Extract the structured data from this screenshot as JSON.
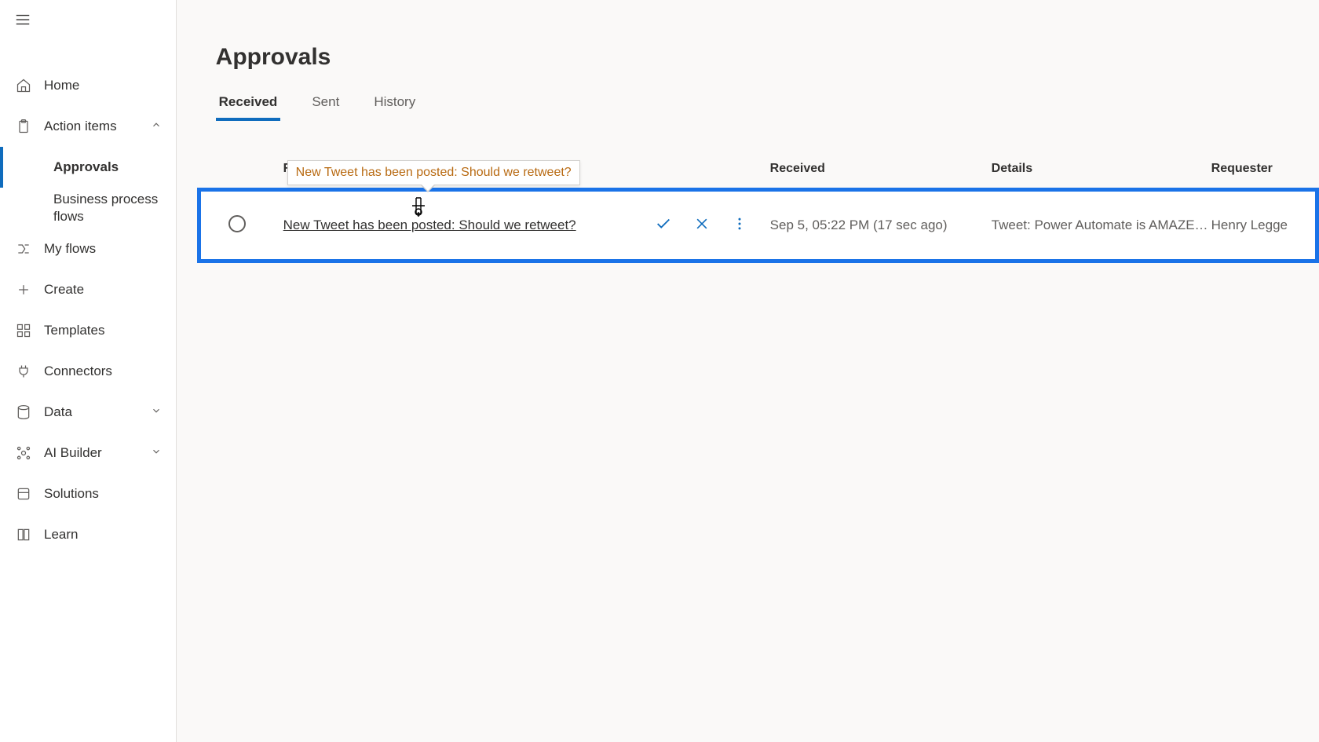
{
  "sidebar": {
    "items": [
      {
        "label": "Home"
      },
      {
        "label": "Action items"
      },
      {
        "label": "Approvals"
      },
      {
        "label": "Business process flows"
      },
      {
        "label": "My flows"
      },
      {
        "label": "Create"
      },
      {
        "label": "Templates"
      },
      {
        "label": "Connectors"
      },
      {
        "label": "Data"
      },
      {
        "label": "AI Builder"
      },
      {
        "label": "Solutions"
      },
      {
        "label": "Learn"
      }
    ]
  },
  "page": {
    "title": "Approvals"
  },
  "tabs": [
    {
      "label": "Received"
    },
    {
      "label": "Sent"
    },
    {
      "label": "History"
    }
  ],
  "columns": {
    "request": "Request",
    "received": "Received",
    "details": "Details",
    "requester": "Requester"
  },
  "rows": [
    {
      "title": "New Tweet has been posted: Should we retweet?",
      "received": "Sep 5, 05:22 PM (17 sec ago)",
      "details": "Tweet: Power Automate is AMAZEBA...",
      "requester": "Henry Legge"
    }
  ],
  "tooltip": {
    "text": "New Tweet has been posted: Should we retweet?"
  }
}
